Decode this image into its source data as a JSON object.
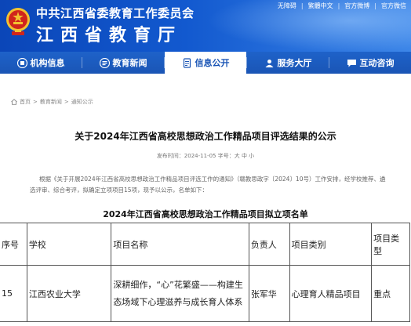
{
  "header": {
    "org_line1": "中共江西省委教育工作委员会",
    "org_line2": "江西省教育厅",
    "top_links": [
      "无障碍",
      "繁體中文",
      "官方微博",
      "官方微信"
    ]
  },
  "nav": {
    "items": [
      {
        "label": "机构信息",
        "icon": "building-icon"
      },
      {
        "label": "教育新闻",
        "icon": "news-icon"
      },
      {
        "label": "信息公开",
        "icon": "document-icon"
      },
      {
        "label": "服务大厅",
        "icon": "service-icon"
      },
      {
        "label": "互动咨询",
        "icon": "chat-icon"
      }
    ],
    "active_index": 2
  },
  "breadcrumb": {
    "items": [
      "首页",
      "教育新闻",
      "通知公示"
    ],
    "separator": ">"
  },
  "article": {
    "title": "关于2024年江西省高校思想政治工作精品项目评选结果的公示",
    "meta": "发布时间：2024-11-05    字号：大 中 小",
    "body_line1": "根据《关于开展2024年江西省高校思想政治工作精品项目评选工作的通知》（赣教思政字〔2024〕10号）工作安排，经学校推荐、遴",
    "body_line2": "选评审、综合考评，拟确定立项项目15项，现予以公示，名单如下："
  },
  "table": {
    "caption": "2024年江西省高校思想政治工作精品项目拟立项名单",
    "headers": [
      "序号",
      "学校",
      "项目名称",
      "负责人",
      "项目类别",
      "项目类型"
    ],
    "rows": [
      {
        "no": "15",
        "school": "江西农业大学",
        "name": "深耕细作，“心”花繁盛——构建生态场域下心理滋养与成长育人体系",
        "owner": "张军华",
        "category": "心理育人精品项目",
        "type": "重点"
      }
    ]
  },
  "colors": {
    "header_blue": "#1259cf",
    "nav_blue": "#1a55b5",
    "emblem_red": "#d0251c",
    "emblem_gold": "#f2c230"
  }
}
